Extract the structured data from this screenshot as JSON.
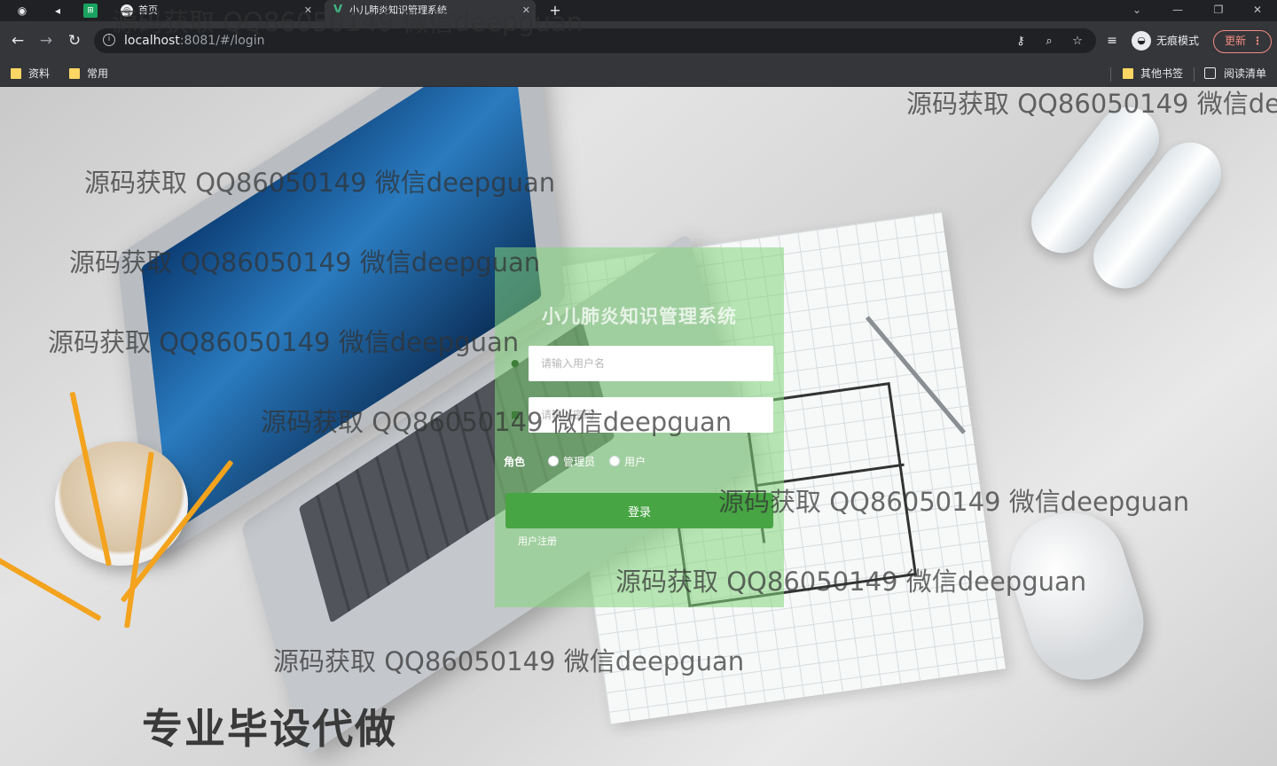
{
  "browser": {
    "tabs": [
      {
        "label": "首页",
        "active": false
      },
      {
        "label": "小儿肺炎知识管理系统",
        "active": true
      }
    ],
    "new_tab_icon": "+",
    "url_host": "localhost",
    "url_rest": ":8081/#/login",
    "incognito_label": "无痕模式",
    "update_label": "更新",
    "bookmarks": [
      "资料",
      "常用"
    ],
    "bookmarks_right": [
      "其他书签",
      "阅读清单"
    ]
  },
  "login": {
    "title": "小儿肺炎知识管理系统",
    "username_placeholder": "请输入用户名",
    "password_placeholder": "请输入密码",
    "role_label": "角色",
    "roles": [
      "管理员",
      "用户"
    ],
    "submit_label": "登录",
    "register_label": "用户注册"
  },
  "watermarks": [
    "源码获取 QQ86050149 微信deepguan",
    "源码获取 QQ86050149 微信deepguan",
    "源码获取 QQ86050149 微信deepguan",
    "源码获取 QQ86050149 微信deepguan",
    "源码获取 QQ86050149 微信deepguan",
    "源码获取 QQ86050149 微信deepguan",
    "源码获取 QQ86050149 微信deepguan",
    "源码获取 QQ86050149 微信deepguan",
    "源码获取 QQ86050149 微信deepguan"
  ],
  "promo": "专业毕设代做",
  "colors": {
    "login_panel": "#84d67c",
    "login_button": "#47a544",
    "browser_dark": "#202124",
    "update_accent": "#f28b82"
  }
}
